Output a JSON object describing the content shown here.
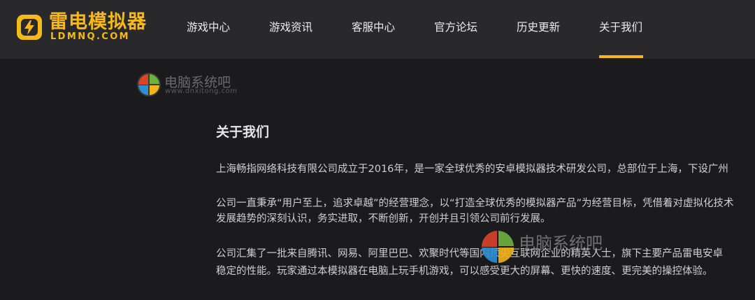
{
  "header": {
    "logo": {
      "title": "雷电模拟器",
      "subtitle": "LDMNQ.COM"
    },
    "nav": [
      {
        "label": "游戏中心",
        "active": false
      },
      {
        "label": "游戏资讯",
        "active": false
      },
      {
        "label": "客服中心",
        "active": false
      },
      {
        "label": "官方论坛",
        "active": false
      },
      {
        "label": "历史更新",
        "active": false
      },
      {
        "label": "关于我们",
        "active": true
      }
    ],
    "accent_color": "#f6b81b"
  },
  "watermark": {
    "text": "电脑系统吧",
    "url": "www.dnxitong.com"
  },
  "main": {
    "title": "关于我们",
    "paragraphs": [
      [
        "上海畅指网络科技有限公司成立于2016年，是一家全球优秀的安卓模拟器技术研发公司，总部位于上海，下设广州"
      ],
      [
        "公司一直秉承“用户至上，追求卓越”的经营理念，以“打造全球优秀的模拟器产品”为经营目标，凭借着对虚拟化技术",
        "发展趋势的深刻认识，务实进取，不断创新，开创并且引领公司前行发展。"
      ],
      [
        "公司汇集了一批来自腾讯、网易、阿里巴巴、欢聚时代等国内顶尖互联网企业的精英人士，旗下主要产品雷电安卓",
        "稳定的性能。玩家通过本模拟器在电脑上玩手机游戏，可以感受更大的屏幕、更快的速度、更完美的操控体验。"
      ]
    ]
  }
}
